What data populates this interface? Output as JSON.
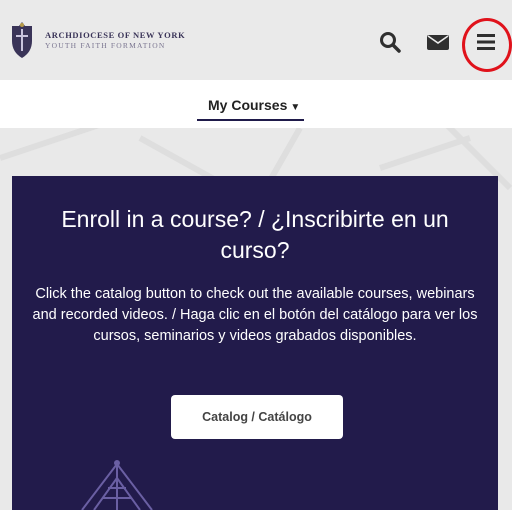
{
  "header": {
    "logo_line1": "ARCHDIOCESE OF NEW YORK",
    "logo_line2": "YOUTH FAITH FORMATION",
    "icons": [
      "search-icon",
      "mail-icon",
      "hamburger-menu-icon"
    ],
    "highlight_color": "#e0121b"
  },
  "nav": {
    "my_courses_label": "My Courses"
  },
  "card": {
    "title": "Enroll in a course? / ¿Inscribirte en un curso?",
    "description": "Click the catalog button to check out the available courses, webinars and recorded videos. / Haga clic en el botón del catálogo para ver los cursos, seminarios y videos grabados disponibles.",
    "button_label": "Catalog / Catálogo",
    "background_color": "#221b4b"
  }
}
